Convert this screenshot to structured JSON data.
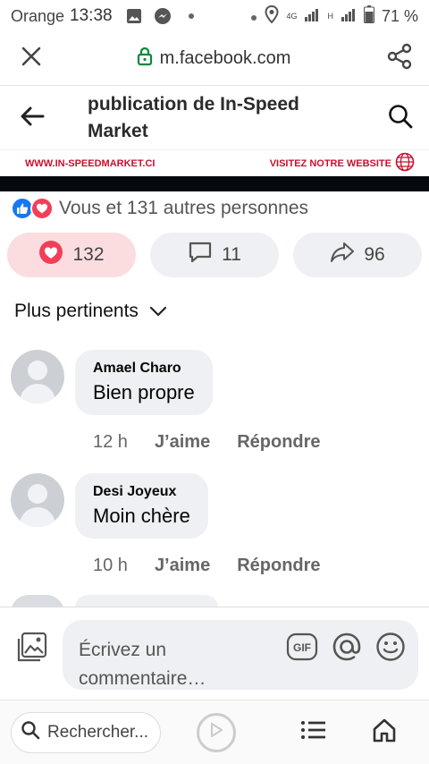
{
  "status_bar": {
    "carrier": "Orange",
    "time": "13:38",
    "network": "4G",
    "network_h": "H",
    "battery": "71 %"
  },
  "browser": {
    "url": "m.facebook.com",
    "close_icon": "close-icon",
    "share_icon": "share-icon",
    "lock_icon": "lock-icon"
  },
  "header": {
    "title": "publication de In-Speed Market"
  },
  "banner": {
    "left": "WWW.IN-SPEEDMARKET.CI",
    "right": "VISITEZ NOTRE WEBSITE"
  },
  "reactions": {
    "summary": "Vous et 131 autres personnes",
    "likes": "132",
    "comments": "11",
    "shares": "96"
  },
  "sort": {
    "label": "Plus pertinents"
  },
  "comments": [
    {
      "author": "Amael Charo",
      "text": "Bien propre",
      "time": "12 h",
      "like": "J’aime",
      "reply": "Répondre"
    },
    {
      "author": "Desi Joyeux",
      "text": "Moin chère",
      "time": "10 h",
      "like": "J’aime",
      "reply": "Répondre"
    }
  ],
  "composer": {
    "placeholder": "Écrivez un commentaire…",
    "gif": "GIF"
  },
  "bottom_nav": {
    "search": "Rechercher..."
  },
  "colors": {
    "like_blue": "#1877f2",
    "love_red": "#f33e58",
    "banner_red": "#c8102e"
  }
}
